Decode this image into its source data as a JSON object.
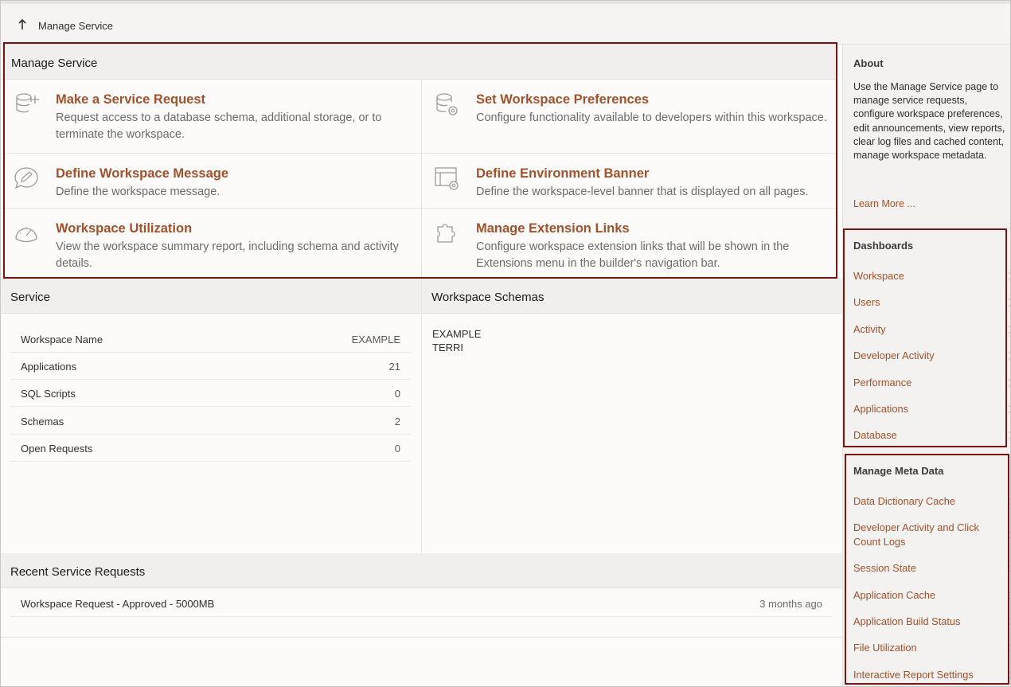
{
  "breadcrumb": {
    "label": "Manage Service"
  },
  "manage_service": {
    "title": "Manage Service",
    "cards": [
      {
        "title": "Make a Service Request",
        "desc": "Request access to a database schema, additional storage, or to terminate the workspace.",
        "icon": "database-add-icon"
      },
      {
        "title": "Set Workspace Preferences",
        "desc": "Configure functionality available to developers within this workspace.",
        "icon": "database-settings-icon"
      },
      {
        "title": "Define Workspace Message",
        "desc": "Define the workspace message.",
        "icon": "message-edit-icon"
      },
      {
        "title": "Define Environment Banner",
        "desc": "Define the workspace-level banner that is displayed on all pages.",
        "icon": "banner-settings-icon"
      },
      {
        "title": "Workspace Utilization",
        "desc": "View the workspace summary report, including schema and activity details.",
        "icon": "gauge-icon"
      },
      {
        "title": "Manage Extension Links",
        "desc": "Configure workspace extension links that will be shown in the Extensions menu in the builder's navigation bar.",
        "icon": "puzzle-icon"
      }
    ]
  },
  "service": {
    "title": "Service",
    "rows": [
      {
        "label": "Workspace Name",
        "value": "EXAMPLE"
      },
      {
        "label": "Applications",
        "value": "21"
      },
      {
        "label": "SQL Scripts",
        "value": "0"
      },
      {
        "label": "Schemas",
        "value": "2"
      },
      {
        "label": "Open Requests",
        "value": "0"
      }
    ]
  },
  "workspace_schemas": {
    "title": "Workspace Schemas",
    "items": [
      "EXAMPLE",
      "TERRI"
    ]
  },
  "recent_requests": {
    "title": "Recent Service Requests",
    "rows": [
      {
        "label": "Workspace Request - Approved - 5000MB",
        "when": "3 months ago"
      }
    ]
  },
  "sidebar": {
    "about_title": "About",
    "about_text": "Use the Manage Service page to manage service requests, configure workspace preferences, edit announcements, view reports, clear log files and cached content, manage workspace metadata.",
    "learn_more": "Learn More ...",
    "dashboards_title": "Dashboards",
    "dashboards": [
      "Workspace",
      "Users",
      "Activity",
      "Developer Activity",
      "Performance",
      "Applications",
      "Database"
    ],
    "metadata_title": "Manage Meta Data",
    "metadata": [
      "Data Dictionary Cache",
      "Developer Activity and Click Count Logs",
      "Session State",
      "Application Cache",
      "Application Build Status",
      "File Utilization",
      "Interactive Report Settings"
    ]
  },
  "colors": {
    "accent": "#a1512b",
    "highlight": "#7a1414"
  }
}
